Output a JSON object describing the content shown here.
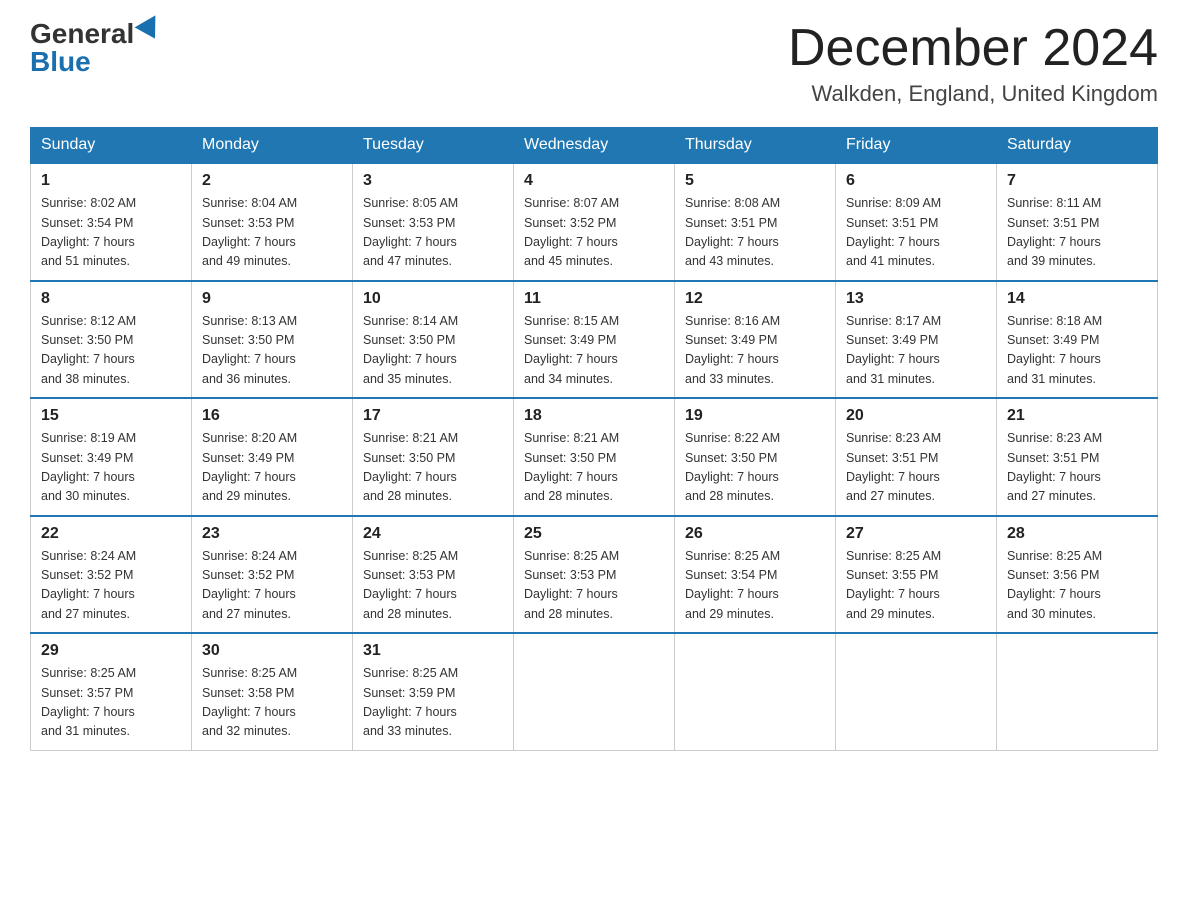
{
  "header": {
    "logo_general": "General",
    "logo_blue": "Blue",
    "month_title": "December 2024",
    "location": "Walkden, England, United Kingdom"
  },
  "days_of_week": [
    "Sunday",
    "Monday",
    "Tuesday",
    "Wednesday",
    "Thursday",
    "Friday",
    "Saturday"
  ],
  "weeks": [
    [
      {
        "day": "1",
        "sunrise": "8:02 AM",
        "sunset": "3:54 PM",
        "daylight": "7 hours and 51 minutes."
      },
      {
        "day": "2",
        "sunrise": "8:04 AM",
        "sunset": "3:53 PM",
        "daylight": "7 hours and 49 minutes."
      },
      {
        "day": "3",
        "sunrise": "8:05 AM",
        "sunset": "3:53 PM",
        "daylight": "7 hours and 47 minutes."
      },
      {
        "day": "4",
        "sunrise": "8:07 AM",
        "sunset": "3:52 PM",
        "daylight": "7 hours and 45 minutes."
      },
      {
        "day": "5",
        "sunrise": "8:08 AM",
        "sunset": "3:51 PM",
        "daylight": "7 hours and 43 minutes."
      },
      {
        "day": "6",
        "sunrise": "8:09 AM",
        "sunset": "3:51 PM",
        "daylight": "7 hours and 41 minutes."
      },
      {
        "day": "7",
        "sunrise": "8:11 AM",
        "sunset": "3:51 PM",
        "daylight": "7 hours and 39 minutes."
      }
    ],
    [
      {
        "day": "8",
        "sunrise": "8:12 AM",
        "sunset": "3:50 PM",
        "daylight": "7 hours and 38 minutes."
      },
      {
        "day": "9",
        "sunrise": "8:13 AM",
        "sunset": "3:50 PM",
        "daylight": "7 hours and 36 minutes."
      },
      {
        "day": "10",
        "sunrise": "8:14 AM",
        "sunset": "3:50 PM",
        "daylight": "7 hours and 35 minutes."
      },
      {
        "day": "11",
        "sunrise": "8:15 AM",
        "sunset": "3:49 PM",
        "daylight": "7 hours and 34 minutes."
      },
      {
        "day": "12",
        "sunrise": "8:16 AM",
        "sunset": "3:49 PM",
        "daylight": "7 hours and 33 minutes."
      },
      {
        "day": "13",
        "sunrise": "8:17 AM",
        "sunset": "3:49 PM",
        "daylight": "7 hours and 31 minutes."
      },
      {
        "day": "14",
        "sunrise": "8:18 AM",
        "sunset": "3:49 PM",
        "daylight": "7 hours and 31 minutes."
      }
    ],
    [
      {
        "day": "15",
        "sunrise": "8:19 AM",
        "sunset": "3:49 PM",
        "daylight": "7 hours and 30 minutes."
      },
      {
        "day": "16",
        "sunrise": "8:20 AM",
        "sunset": "3:49 PM",
        "daylight": "7 hours and 29 minutes."
      },
      {
        "day": "17",
        "sunrise": "8:21 AM",
        "sunset": "3:50 PM",
        "daylight": "7 hours and 28 minutes."
      },
      {
        "day": "18",
        "sunrise": "8:21 AM",
        "sunset": "3:50 PM",
        "daylight": "7 hours and 28 minutes."
      },
      {
        "day": "19",
        "sunrise": "8:22 AM",
        "sunset": "3:50 PM",
        "daylight": "7 hours and 28 minutes."
      },
      {
        "day": "20",
        "sunrise": "8:23 AM",
        "sunset": "3:51 PM",
        "daylight": "7 hours and 27 minutes."
      },
      {
        "day": "21",
        "sunrise": "8:23 AM",
        "sunset": "3:51 PM",
        "daylight": "7 hours and 27 minutes."
      }
    ],
    [
      {
        "day": "22",
        "sunrise": "8:24 AM",
        "sunset": "3:52 PM",
        "daylight": "7 hours and 27 minutes."
      },
      {
        "day": "23",
        "sunrise": "8:24 AM",
        "sunset": "3:52 PM",
        "daylight": "7 hours and 27 minutes."
      },
      {
        "day": "24",
        "sunrise": "8:25 AM",
        "sunset": "3:53 PM",
        "daylight": "7 hours and 28 minutes."
      },
      {
        "day": "25",
        "sunrise": "8:25 AM",
        "sunset": "3:53 PM",
        "daylight": "7 hours and 28 minutes."
      },
      {
        "day": "26",
        "sunrise": "8:25 AM",
        "sunset": "3:54 PM",
        "daylight": "7 hours and 29 minutes."
      },
      {
        "day": "27",
        "sunrise": "8:25 AM",
        "sunset": "3:55 PM",
        "daylight": "7 hours and 29 minutes."
      },
      {
        "day": "28",
        "sunrise": "8:25 AM",
        "sunset": "3:56 PM",
        "daylight": "7 hours and 30 minutes."
      }
    ],
    [
      {
        "day": "29",
        "sunrise": "8:25 AM",
        "sunset": "3:57 PM",
        "daylight": "7 hours and 31 minutes."
      },
      {
        "day": "30",
        "sunrise": "8:25 AM",
        "sunset": "3:58 PM",
        "daylight": "7 hours and 32 minutes."
      },
      {
        "day": "31",
        "sunrise": "8:25 AM",
        "sunset": "3:59 PM",
        "daylight": "7 hours and 33 minutes."
      },
      null,
      null,
      null,
      null
    ]
  ],
  "labels": {
    "sunrise": "Sunrise: ",
    "sunset": "Sunset: ",
    "daylight": "Daylight: "
  }
}
